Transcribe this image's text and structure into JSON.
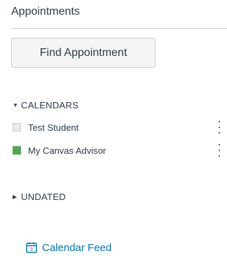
{
  "panel": {
    "title": "Appointments",
    "find_button_label": "Find Appointment"
  },
  "calendars": {
    "section_label": "CALENDARS",
    "expanded": true,
    "items": [
      {
        "label": "Test Student",
        "color": "#e9ebed",
        "checked": false
      },
      {
        "label": "My Canvas Advisor",
        "color": "#53a653",
        "checked": true
      }
    ]
  },
  "undated": {
    "section_label": "UNDATED",
    "expanded": false
  },
  "feed": {
    "label": "Calendar Feed",
    "icon": "calendar-icon",
    "icon_day": "3",
    "color": "#0073bb"
  }
}
